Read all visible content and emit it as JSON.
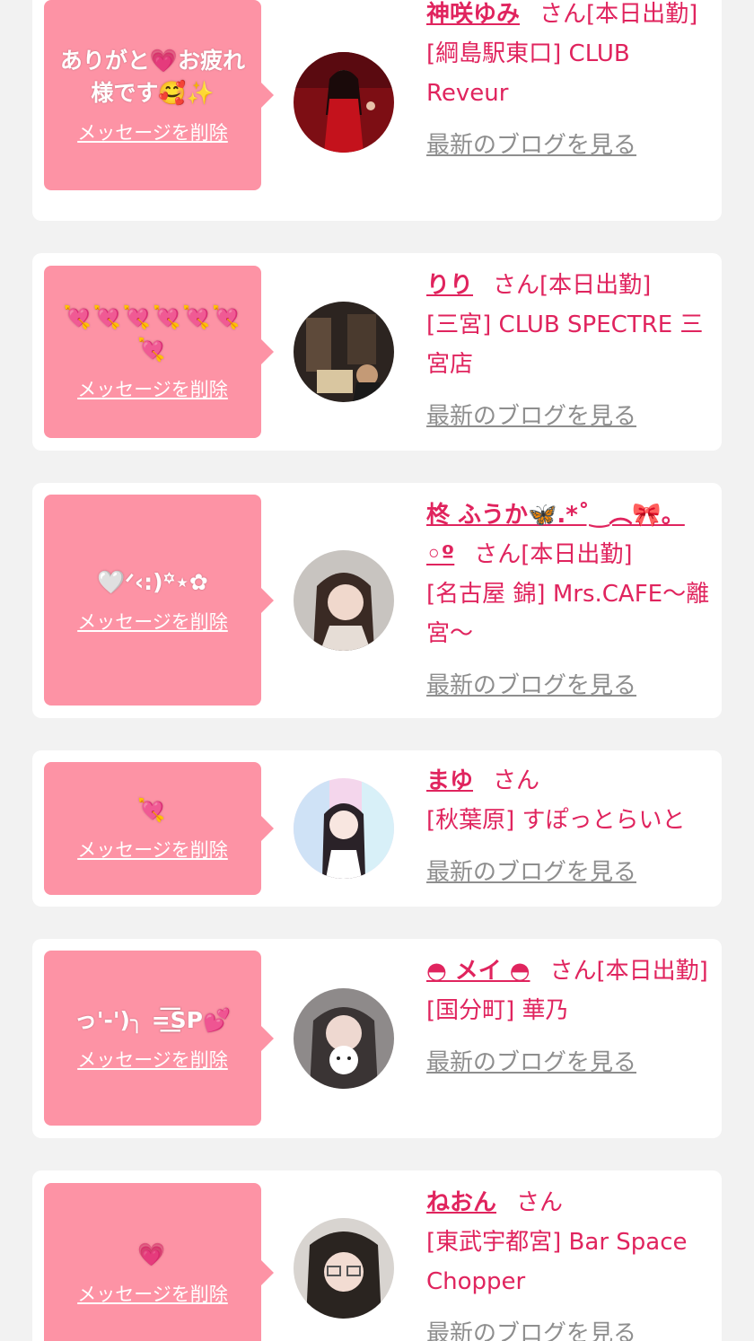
{
  "delete_label": "メッセージを削除",
  "blog_label": "最新のブログを見る",
  "colors": {
    "bubble": "#fd93a5",
    "accent": "#e0245e",
    "muted": "#8e8e8e",
    "background": "#f2f2f2"
  },
  "messages": [
    {
      "message": "ありがと💗お疲れ様です🥰✨",
      "name": "神咲ゆみ",
      "status": "さん[本日出勤]",
      "shop": "[綱島駅東口] CLUB Reveur",
      "avatar_icon": "avatar-photo"
    },
    {
      "message": "💘💘💘💘💘💘💘",
      "name": "りり",
      "status": "さん[本日出勤]",
      "shop": "[三宮] CLUB SPECTRE 三宮店",
      "avatar_icon": "avatar-photo"
    },
    {
      "message": "🤍ᐟ‹:)꙳⋆✿",
      "name": "柊 ふうか🦋.*˚‿︵🎀。◦º",
      "status": "さん[本日出勤]",
      "shop": "[名古屋 錦] Mrs.CAFE〜離宮〜",
      "avatar_icon": "avatar-photo"
    },
    {
      "message": "💘",
      "name": "まゆ",
      "status": "さん",
      "shop": "[秋葉原] すぽっとらいと",
      "avatar_icon": "avatar-photo"
    },
    {
      "message": "っ'-')╮ =͟͟͞͞SP💕",
      "name": "◓ メイ ◓",
      "status": "さん[本日出勤]",
      "shop": "[国分町] 華乃",
      "avatar_icon": "avatar-photo"
    },
    {
      "message": "💗",
      "name": "ねおん",
      "status": "さん",
      "shop": "[東武宇都宮] Bar Space Chopper",
      "avatar_icon": "avatar-photo"
    }
  ]
}
